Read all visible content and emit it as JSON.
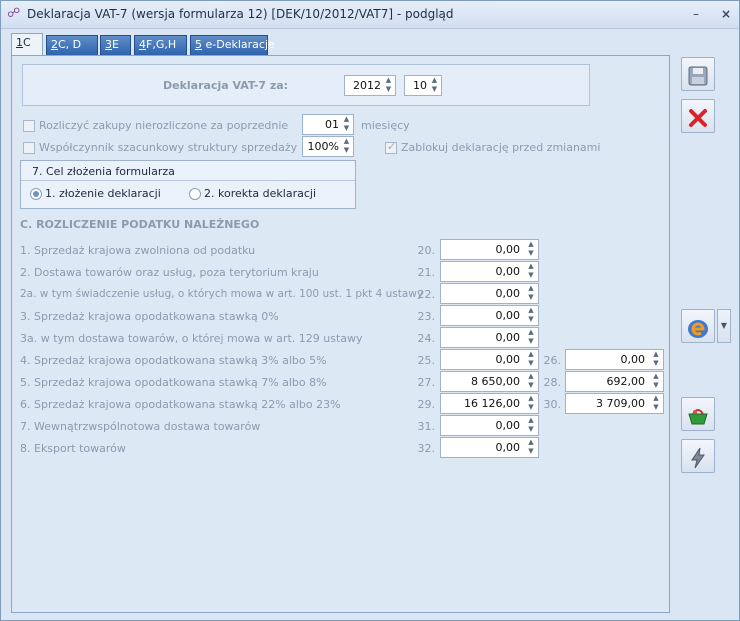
{
  "window": {
    "title": "Deklaracja VAT-7 (wersja formularza 12) [DEK/10/2012/VAT7] - podgląd",
    "min_glyph": "–",
    "close_glyph": "×"
  },
  "tabs": [
    {
      "key": "1",
      "label": "C",
      "active": true
    },
    {
      "key": "2",
      "label": "C, D"
    },
    {
      "key": "3",
      "label": "E"
    },
    {
      "key": "4",
      "label": "F,G,H"
    },
    {
      "key": "5",
      "label": "e-Deklaracje"
    }
  ],
  "period": {
    "label": "Deklaracja VAT-7 za:",
    "year": "2012",
    "month": "10"
  },
  "options": {
    "settle_purchases_label": "Rozliczyć zakupy nierozliczone za poprzednie",
    "settle_months_value": "01",
    "settle_months_unit": "miesięcy",
    "coefficient_label": "Współczynnik szacunkowy struktury sprzedaży",
    "coefficient_value": "100%",
    "lock_label": "Zablokuj deklarację przed zmianami"
  },
  "purpose": {
    "title": "7. Cel złożenia formularza",
    "option1": "1. złożenie deklaracji",
    "option2": "2. korekta deklaracji"
  },
  "section_c": {
    "title": "C. ROZLICZENIE PODATKU NALEŻNEGO",
    "rows": [
      {
        "label": "1. Sprzedaż krajowa zwolniona od podatku",
        "num1": "20.",
        "val1": "0,00"
      },
      {
        "label": "2. Dostawa towarów oraz usług, poza terytorium kraju",
        "num1": "21.",
        "val1": "0,00"
      },
      {
        "label": "2a. w tym świadczenie usług, o których mowa w art. 100 ust. 1 pkt 4 ustawy",
        "num1": "22.",
        "val1": "0,00"
      },
      {
        "label": "3. Sprzedaż krajowa opodatkowana stawką 0%",
        "num1": "23.",
        "val1": "0,00"
      },
      {
        "label": "3a. w tym dostawa towarów, o której mowa w art. 129 ustawy",
        "num1": "24.",
        "val1": "0,00"
      },
      {
        "label": "4. Sprzedaż krajowa opodatkowana stawką 3% albo 5%",
        "num1": "25.",
        "val1": "0,00",
        "num2": "26.",
        "val2": "0,00"
      },
      {
        "label": "5. Sprzedaż krajowa opodatkowana stawką 7% albo 8%",
        "num1": "27.",
        "val1": "8 650,00",
        "num2": "28.",
        "val2": "692,00"
      },
      {
        "label": "6. Sprzedaż krajowa opodatkowana stawką 22% albo 23%",
        "num1": "29.",
        "val1": "16 126,00",
        "num2": "30.",
        "val2": "3 709,00"
      },
      {
        "label": "7. Wewnątrzwspólnotowa dostawa towarów",
        "num1": "31.",
        "val1": "0,00"
      },
      {
        "label": "8. Eksport towarów",
        "num1": "32.",
        "val1": "0,00"
      }
    ]
  },
  "glyphs": {
    "spin_up": "▲",
    "spin_down": "▼",
    "dropdown": "▼"
  },
  "side_buttons": {
    "save_icon": "save-icon",
    "cancel_icon": "cancel-icon",
    "edeclaration_icon": "e-declaration-icon",
    "basket_icon": "basket-icon",
    "lightning_icon": "lightning-icon"
  }
}
